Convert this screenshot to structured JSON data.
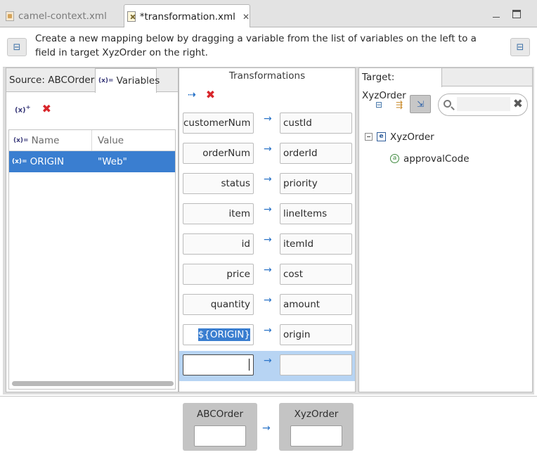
{
  "tabs": [
    {
      "label": "camel-context.xml",
      "active": false
    },
    {
      "label": "*transformation.xml",
      "active": true
    }
  ],
  "instruction": "Create a new mapping below by dragging a variable from the list of variables on the left to a field in target XyzOrder on the right.",
  "source": {
    "tabs": [
      {
        "label": "Source: ABCOrder"
      },
      {
        "label": "Variables"
      }
    ],
    "var_glyph": "(x)=",
    "columns": {
      "name": "Name",
      "value": "Value"
    },
    "variables": [
      {
        "name": "ORIGIN",
        "value": "\"Web\""
      }
    ]
  },
  "transformations": {
    "title": "Transformations",
    "mappings": [
      {
        "source": "customerNum",
        "target": "custId"
      },
      {
        "source": "orderNum",
        "target": "orderId"
      },
      {
        "source": "status",
        "target": "priority"
      },
      {
        "source": "item",
        "target": "lineItems"
      },
      {
        "source": "id",
        "target": "itemId"
      },
      {
        "source": "price",
        "target": "cost"
      },
      {
        "source": "quantity",
        "target": "amount"
      },
      {
        "source": "${ORIGIN}",
        "target": "origin"
      },
      {
        "source": "",
        "target": ""
      }
    ]
  },
  "target": {
    "tab_label": "Target: XyzOrder",
    "search_placeholder": "",
    "tree": {
      "root": {
        "label": "XyzOrder",
        "icon": "e"
      },
      "children": [
        {
          "label": "approvalCode",
          "icon": "a"
        }
      ]
    }
  },
  "summary": {
    "source_label": "ABCOrder",
    "target_label": "XyzOrder"
  },
  "colors": {
    "selection": "#3a7ed0",
    "selected_row": "#b7d4f3",
    "arrow": "#2a74c8",
    "delete": "#d8262b"
  }
}
